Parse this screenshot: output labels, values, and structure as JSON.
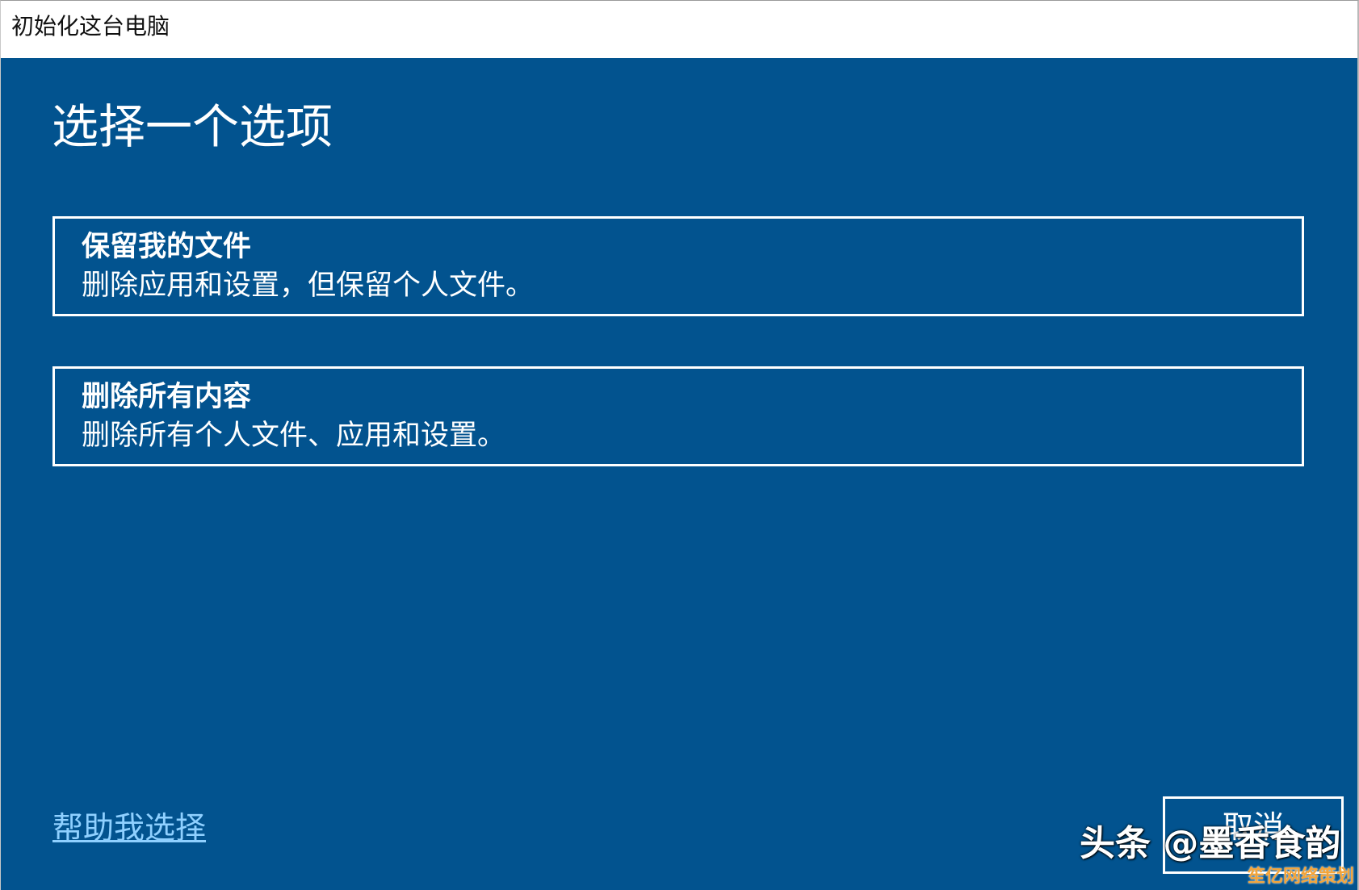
{
  "window": {
    "title": "初始化这台电脑"
  },
  "main": {
    "heading": "选择一个选项",
    "options": [
      {
        "title": "保留我的文件",
        "description": "删除应用和设置，但保留个人文件。"
      },
      {
        "title": "删除所有内容",
        "description": "删除所有个人文件、应用和设置。"
      }
    ],
    "help_link": "帮助我选择",
    "cancel_label": "取消"
  },
  "overlay": {
    "watermark": "头条 @墨香食韵",
    "corner_badge": "笙亿网络策划"
  },
  "colors": {
    "background": "#02538f",
    "link": "#8fd0ff",
    "badge": "#f4a53a"
  }
}
